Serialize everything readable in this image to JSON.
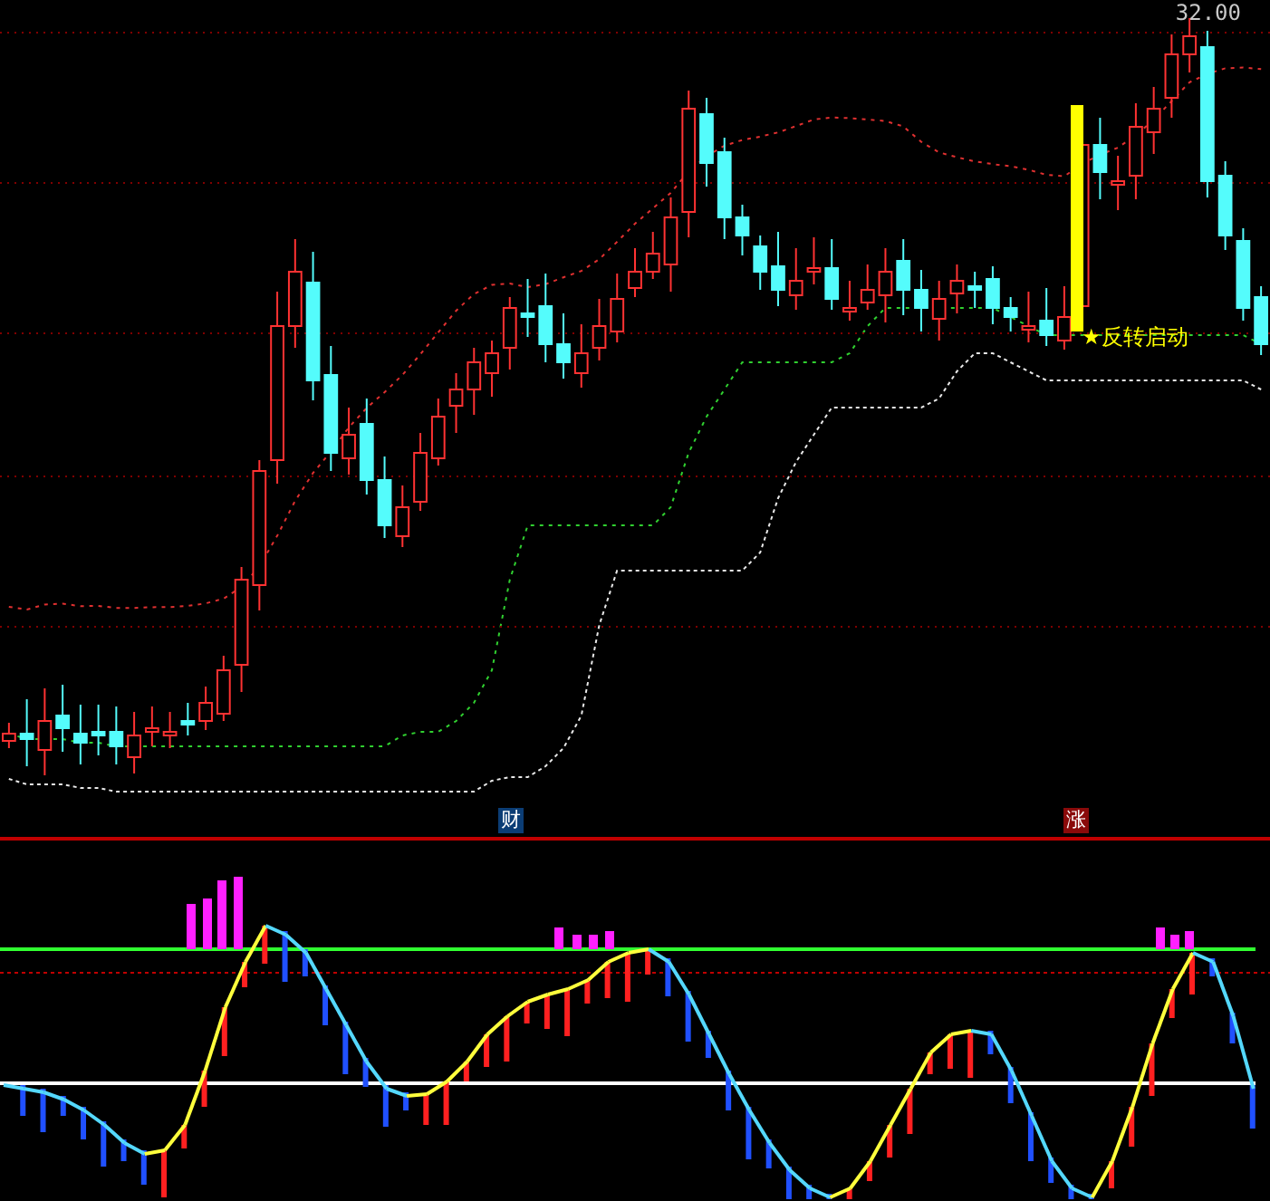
{
  "price_chart": {
    "price_label": "32.00",
    "signal_label": "★反转启动"
  },
  "indicator_chart": {
    "markers": [
      {
        "text": "财",
        "color": "#0b3d75"
      },
      {
        "text": "涨",
        "color": "#8a0a0a"
      }
    ]
  }
}
